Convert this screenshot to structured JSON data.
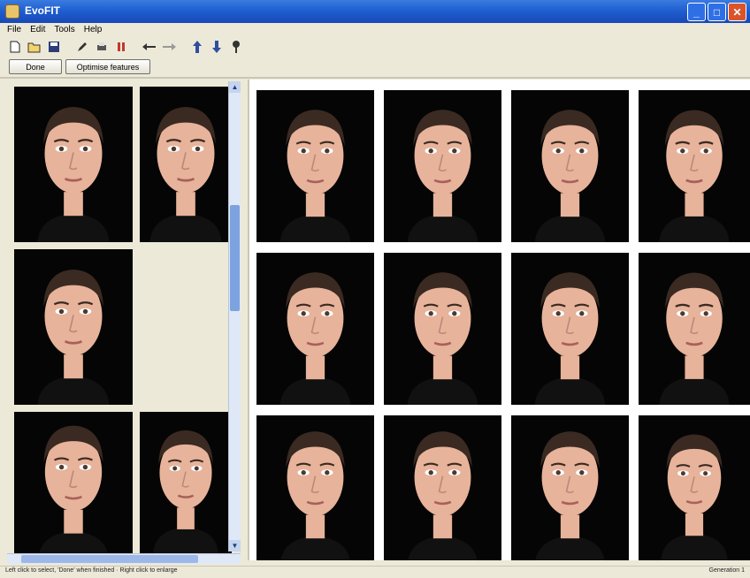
{
  "window": {
    "title": "EvoFIT"
  },
  "titlebar": {
    "minimize_glyph": "_",
    "maximize_glyph": "□",
    "close_glyph": "✕"
  },
  "menu": [
    "File",
    "Edit",
    "Tools",
    "Help"
  ],
  "toolbar": {
    "icons": [
      "new-icon",
      "open-icon",
      "save-icon",
      "edit-icon",
      "print-icon",
      "stop-icon",
      "undo-icon",
      "redo-icon",
      "up-arrow-icon",
      "down-arrow-icon",
      "pin-icon"
    ]
  },
  "actions": {
    "done_label": "Done",
    "optimise_label": "Optimise features"
  },
  "status": {
    "left_message": "Left click to select, 'Done' when finished · Right click to enlarge",
    "right_message": "Generation 1"
  },
  "colors": {
    "titlebar": "#1f5fd0",
    "window_bg": "#ece9d8",
    "tile_bg": "#050505",
    "skin": "#e7b39a",
    "hair": "#3a2a22"
  }
}
